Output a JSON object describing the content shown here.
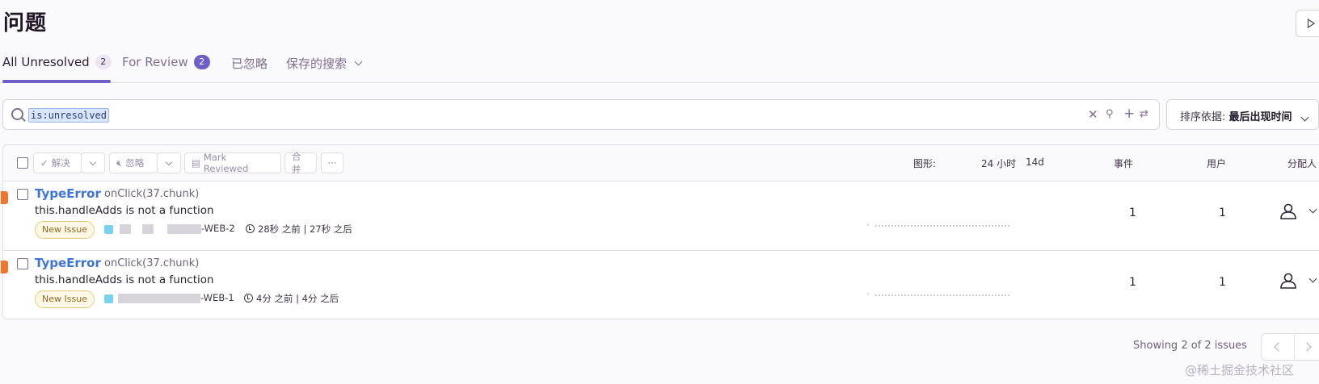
{
  "page": {
    "title": "问题"
  },
  "tabs": [
    {
      "label": "All Unresolved",
      "count": "2"
    },
    {
      "label": "For Review",
      "count": "2"
    },
    {
      "label": "已忽略"
    },
    {
      "label": "保存的搜索"
    }
  ],
  "search": {
    "query": "is:unresolved",
    "icons": [
      "clear-icon",
      "pin-icon",
      "add-icon",
      "swap-icon"
    ]
  },
  "sort": {
    "prefix": "排序依据:",
    "value": "最后出现时间"
  },
  "toolbar": {
    "resolve_label": "解决",
    "ignore_label": "忽略",
    "mark_reviewed_label": "Mark Reviewed",
    "merge_label": "合并",
    "more_label": "···"
  },
  "columns": {
    "graph_label": "图形:",
    "period_24h": "24 小时",
    "period_14d": "14d",
    "events": "事件",
    "users": "用户",
    "assignee": "分配人"
  },
  "issues": [
    {
      "type": "TypeError",
      "culprit": "onClick(37.chunk)",
      "message": "this.handleAdds is not a function",
      "badge": "New Issue",
      "project_suffix": "-WEB-2",
      "first_seen": "28秒 之前",
      "last_seen": "27秒 之后",
      "events": "1",
      "users": "1",
      "level_color": "#f2762e"
    },
    {
      "type": "TypeError",
      "culprit": "onClick(37.chunk)",
      "message": "this.handleAdds is not a function",
      "badge": "New Issue",
      "project_suffix": "-WEB-1",
      "first_seen": "4分 之前",
      "last_seen": "4分 之后",
      "events": "1",
      "users": "1",
      "level_color": "#f2762e"
    }
  ],
  "pagination": {
    "text": "Showing 2 of 2 issues"
  },
  "watermark": "@稀土掘金技术社区",
  "colors": {
    "accent": "#6c5fc7",
    "link": "#3d74db",
    "level_error": "#f2762e"
  }
}
